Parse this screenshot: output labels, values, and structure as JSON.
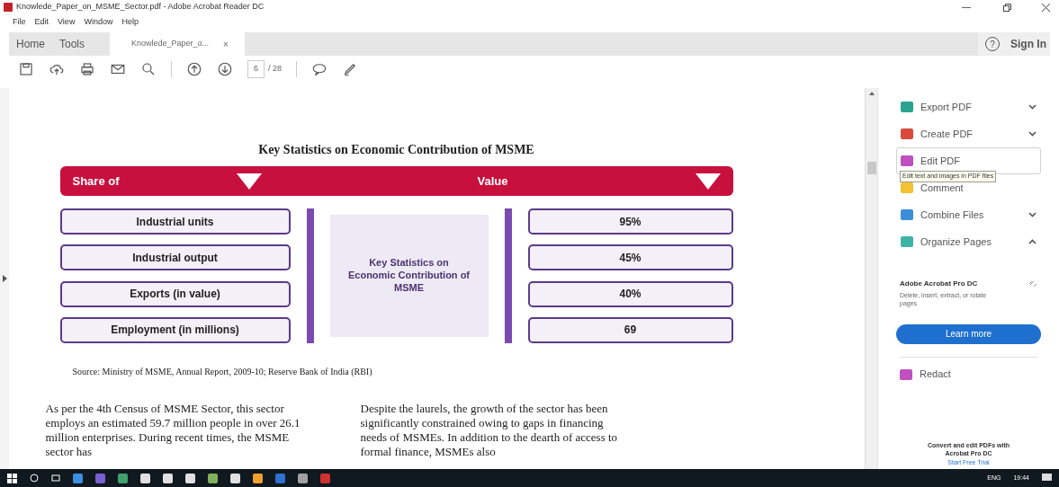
{
  "window": {
    "title": "Knowlede_Paper_on_MSME_Sector.pdf - Adobe Acrobat Reader DC"
  },
  "menu": [
    "File",
    "Edit",
    "View",
    "Window",
    "Help"
  ],
  "tabs": [
    {
      "label": "Home",
      "selected": false
    },
    {
      "label": "Tools",
      "selected": false
    },
    {
      "label": "Knowlede_Paper_o...",
      "selected": true,
      "close": "×"
    }
  ],
  "help": "?",
  "sign_in": "Sign In",
  "toolbar": {
    "page": "6",
    "total": "/ 28"
  },
  "document": {
    "heading": "Key Statistics on Economic Contribution of MSME",
    "left_header": "Share of",
    "right_header": "Value",
    "center": "Key Statistics on Economic Contribution of MSME",
    "rows": [
      {
        "label": "Industrial units",
        "value": "95%"
      },
      {
        "label": "Industrial output",
        "value": "45%"
      },
      {
        "label": "Exports (in value)",
        "value": "40%"
      },
      {
        "label": "Employment (in millions)",
        "value": "69"
      }
    ],
    "source": "Source: Ministry of MSME, Annual Report, 2009-10; Reserve Bank of India (RBI)",
    "paragraphs": [
      "As per the 4th Census of MSME Sector, this sector employs an estimated 59.7 million people in over 26.1 million enterprises. During recent times, the MSME sector has",
      "Despite the laurels, the growth of the sector has been significantly constrained owing to gaps in financing needs of MSMEs. In addition to the dearth of access to formal finance, MSMEs also"
    ]
  },
  "tools_panel": {
    "items": [
      {
        "label": "Export PDF",
        "kind": "expandable",
        "expanded": false,
        "selected": false,
        "color": "#2aa38f"
      },
      {
        "label": "Create PDF",
        "kind": "expandable",
        "expanded": false,
        "selected": false,
        "color": "#d94a3a"
      },
      {
        "label": "Edit PDF",
        "kind": "plain",
        "selected": true,
        "color": "#c04fc0"
      },
      {
        "label": "Comment",
        "kind": "plain",
        "selected": false,
        "color": "#f2c230"
      },
      {
        "label": "Combine Files",
        "kind": "expandable",
        "expanded": false,
        "selected": false,
        "color": "#3b8ed8"
      },
      {
        "label": "Organize Pages",
        "kind": "expandable",
        "expanded": true,
        "selected": false,
        "color": "#3fb3a5"
      }
    ],
    "tooltip": "Edit text and images in PDF files",
    "promo": {
      "title": "Adobe Acrobat Pro DC",
      "text": "Delete, insert, extract, or rotate pages",
      "button": "Learn more"
    },
    "extra": {
      "label": "Redact",
      "color": "#c04fc0"
    },
    "footer": {
      "text": "Convert and edit PDFs with Acrobat Pro DC",
      "link": "Start Free Trial"
    }
  },
  "taskbar": {
    "language": "ENG",
    "time": "19:44"
  }
}
